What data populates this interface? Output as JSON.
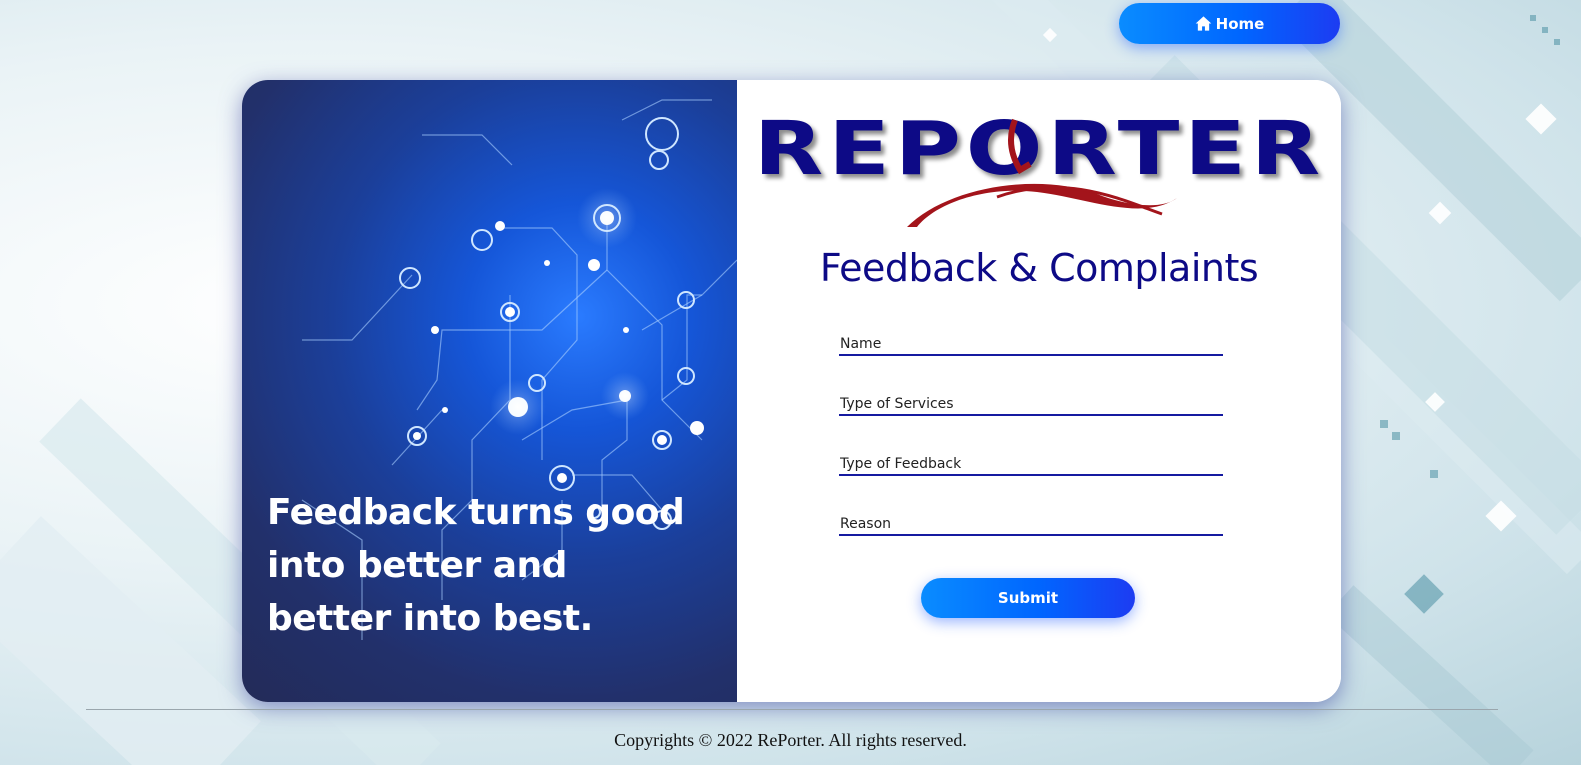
{
  "nav": {
    "home_label": "Home"
  },
  "hero": {
    "tagline": "Feedback turns good into better and better into best."
  },
  "brand": {
    "logo_text": "REPORTER"
  },
  "form": {
    "title": "Feedback & Complaints",
    "name_placeholder": "Name",
    "service_placeholder": "Type of Services",
    "feedback_placeholder": "Type of Feedback",
    "reason_placeholder": "Reason",
    "submit_label": "Submit"
  },
  "footer": {
    "copyright": "Copyrights © 2022 RePorter. All rights reserved."
  },
  "colors": {
    "brand_navy": "#0d0a86",
    "button_gradient_start": "#0a8cff",
    "button_gradient_end": "#1d3cf2",
    "logo_accent_red": "#a3141b"
  }
}
